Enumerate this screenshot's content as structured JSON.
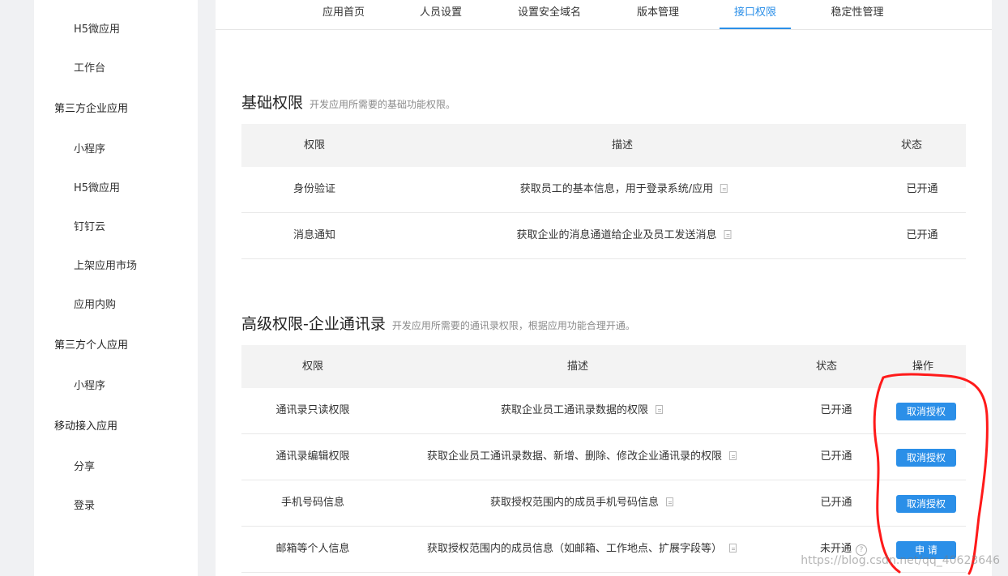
{
  "sidebar": {
    "items": [
      {
        "label": "H5微应用",
        "type": "sub"
      },
      {
        "label": "工作台",
        "type": "sub"
      },
      {
        "label": "第三方企业应用",
        "type": "group"
      },
      {
        "label": "小程序",
        "type": "sub"
      },
      {
        "label": "H5微应用",
        "type": "sub"
      },
      {
        "label": "钉钉云",
        "type": "sub"
      },
      {
        "label": "上架应用市场",
        "type": "sub"
      },
      {
        "label": "应用内购",
        "type": "sub"
      },
      {
        "label": "第三方个人应用",
        "type": "group"
      },
      {
        "label": "小程序",
        "type": "sub"
      },
      {
        "label": "移动接入应用",
        "type": "group"
      },
      {
        "label": "分享",
        "type": "sub"
      },
      {
        "label": "登录",
        "type": "sub"
      }
    ]
  },
  "tabs": [
    {
      "label": "应用首页"
    },
    {
      "label": "人员设置"
    },
    {
      "label": "设置安全域名"
    },
    {
      "label": "版本管理"
    },
    {
      "label": "接口权限",
      "active": true
    },
    {
      "label": "稳定性管理"
    }
  ],
  "basic": {
    "title": "基础权限",
    "desc": "开发应用所需要的基础功能权限。",
    "headers": {
      "perm": "权限",
      "desc": "描述",
      "status": "状态"
    },
    "rows": [
      {
        "perm": "身份验证",
        "desc": "获取员工的基本信息，用于登录系统/应用",
        "status": "已开通"
      },
      {
        "perm": "消息通知",
        "desc": "获取企业的消息通道给企业及员工发送消息",
        "status": "已开通"
      }
    ]
  },
  "advanced": {
    "title": "高级权限-企业通讯录",
    "desc": "开发应用所需要的通讯录权限，根据应用功能合理开通。",
    "headers": {
      "perm": "权限",
      "desc": "描述",
      "status": "状态",
      "action": "操作"
    },
    "rows": [
      {
        "perm": "通讯录只读权限",
        "desc": "获取企业员工通讯录数据的权限",
        "status": "已开通",
        "action": "取消授权"
      },
      {
        "perm": "通讯录编辑权限",
        "desc": "获取企业员工通讯录数据、新增、删除、修改企业通讯录的权限",
        "status": "已开通",
        "action": "取消授权"
      },
      {
        "perm": "手机号码信息",
        "desc": "获取授权范围内的成员手机号码信息",
        "status": "已开通",
        "action": "取消授权"
      },
      {
        "perm": "邮箱等个人信息",
        "desc": "获取授权范围内的成员信息（如邮箱、工作地点、扩展字段等）",
        "status": "未开通",
        "action": "申 请"
      }
    ]
  },
  "watermark": "https://blog.csdn.net/qq_40623646",
  "colors": {
    "accent": "#2b8fe8",
    "annotation": "#ff1a1a"
  }
}
